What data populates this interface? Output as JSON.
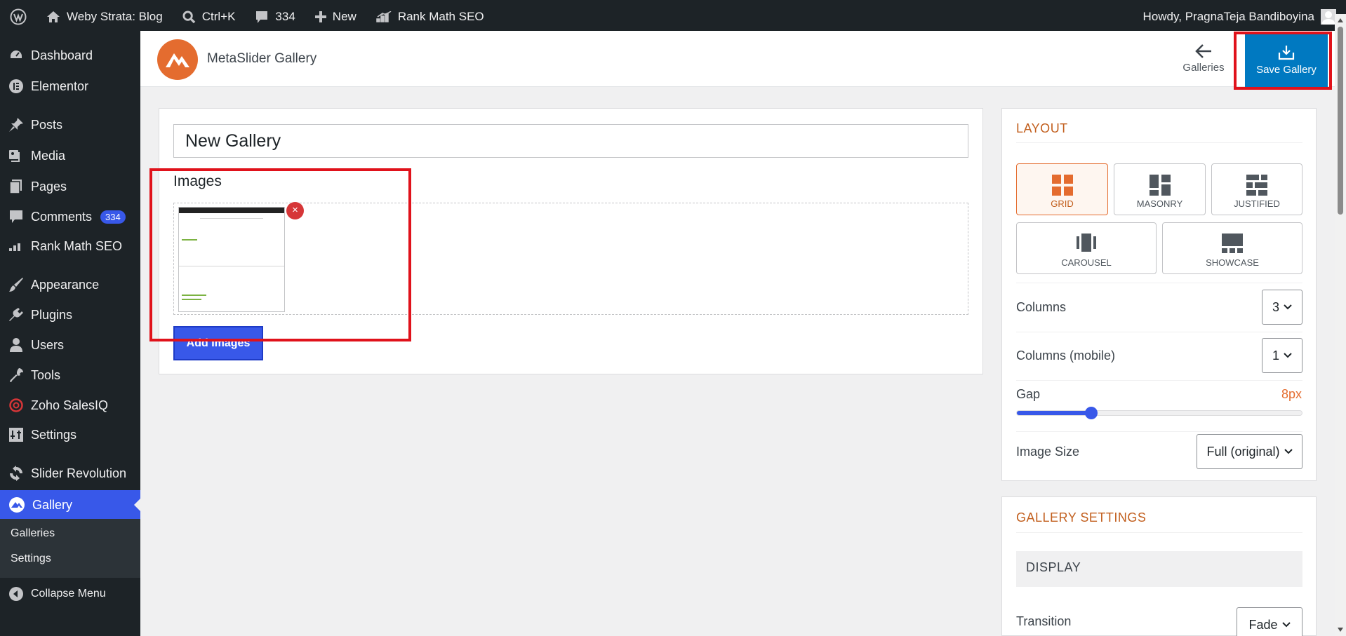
{
  "adminbar": {
    "site_name": "Weby Strata: Blog",
    "search_shortcut": "Ctrl+K",
    "comments_count": "334",
    "new_label": "New",
    "seo_label": "Rank Math SEO",
    "howdy": "Howdy, PragnaTeja Bandiboyina"
  },
  "sidebar": {
    "dashboard": "Dashboard",
    "elementor": "Elementor",
    "posts": "Posts",
    "media": "Media",
    "pages": "Pages",
    "comments": "Comments",
    "comments_badge": "334",
    "rankmath": "Rank Math SEO",
    "appearance": "Appearance",
    "plugins": "Plugins",
    "users": "Users",
    "tools": "Tools",
    "zoho": "Zoho SalesIQ",
    "settings": "Settings",
    "slider_revolution": "Slider Revolution",
    "gallery": "Gallery",
    "sub_galleries": "Galleries",
    "sub_settings": "Settings",
    "collapse": "Collapse Menu"
  },
  "header": {
    "app_title": "MetaSlider Gallery",
    "galleries_link": "Galleries",
    "save_button": "Save Gallery"
  },
  "main": {
    "gallery_title": "New Gallery",
    "images_label": "Images",
    "remove_symbol": "×",
    "add_images_button": "Add Images"
  },
  "layout": {
    "section_title": "LAYOUT",
    "options": [
      "GRID",
      "MASONRY",
      "JUSTIFIED",
      "CAROUSEL",
      "SHOWCASE"
    ],
    "selected": "GRID",
    "columns_label": "Columns",
    "columns_value": "3",
    "columns_mobile_label": "Columns (mobile)",
    "columns_mobile_value": "1",
    "gap_label": "Gap",
    "gap_value": "8px",
    "gap_fraction": 0.26,
    "image_size_label": "Image Size",
    "image_size_value": "Full (original)"
  },
  "gallery_settings": {
    "section_title": "GALLERY SETTINGS",
    "display_header": "DISPLAY",
    "transition_label": "Transition",
    "transition_value": "Fade"
  },
  "colors": {
    "wp_dark": "#1d2327",
    "wp_accent": "#3858e9",
    "metaslider_orange": "#e46c2f",
    "save_blue": "#0079c1",
    "highlight_red": "#e0121b"
  }
}
